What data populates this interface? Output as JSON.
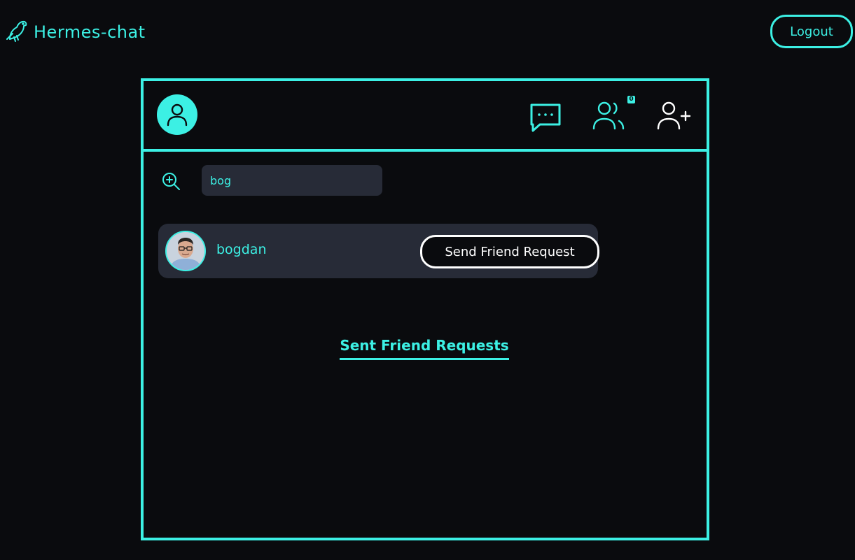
{
  "app": {
    "name": "Hermes-chat",
    "logout_label": "Logout"
  },
  "header": {
    "icons": [
      "user-avatar-icon",
      "chat-icon",
      "friends-icon",
      "add-friend-icon"
    ],
    "friends_badge": "0"
  },
  "search": {
    "value": "bog",
    "placeholder": ""
  },
  "results": [
    {
      "name": "bogdan",
      "action_label": "Send Friend Request"
    }
  ],
  "sent_requests": {
    "title": "Sent Friend Requests",
    "items": []
  },
  "colors": {
    "accent": "#3cf0e4",
    "background": "#0a0b0e",
    "surface": "#272b37",
    "button_border": "#ffffff"
  }
}
